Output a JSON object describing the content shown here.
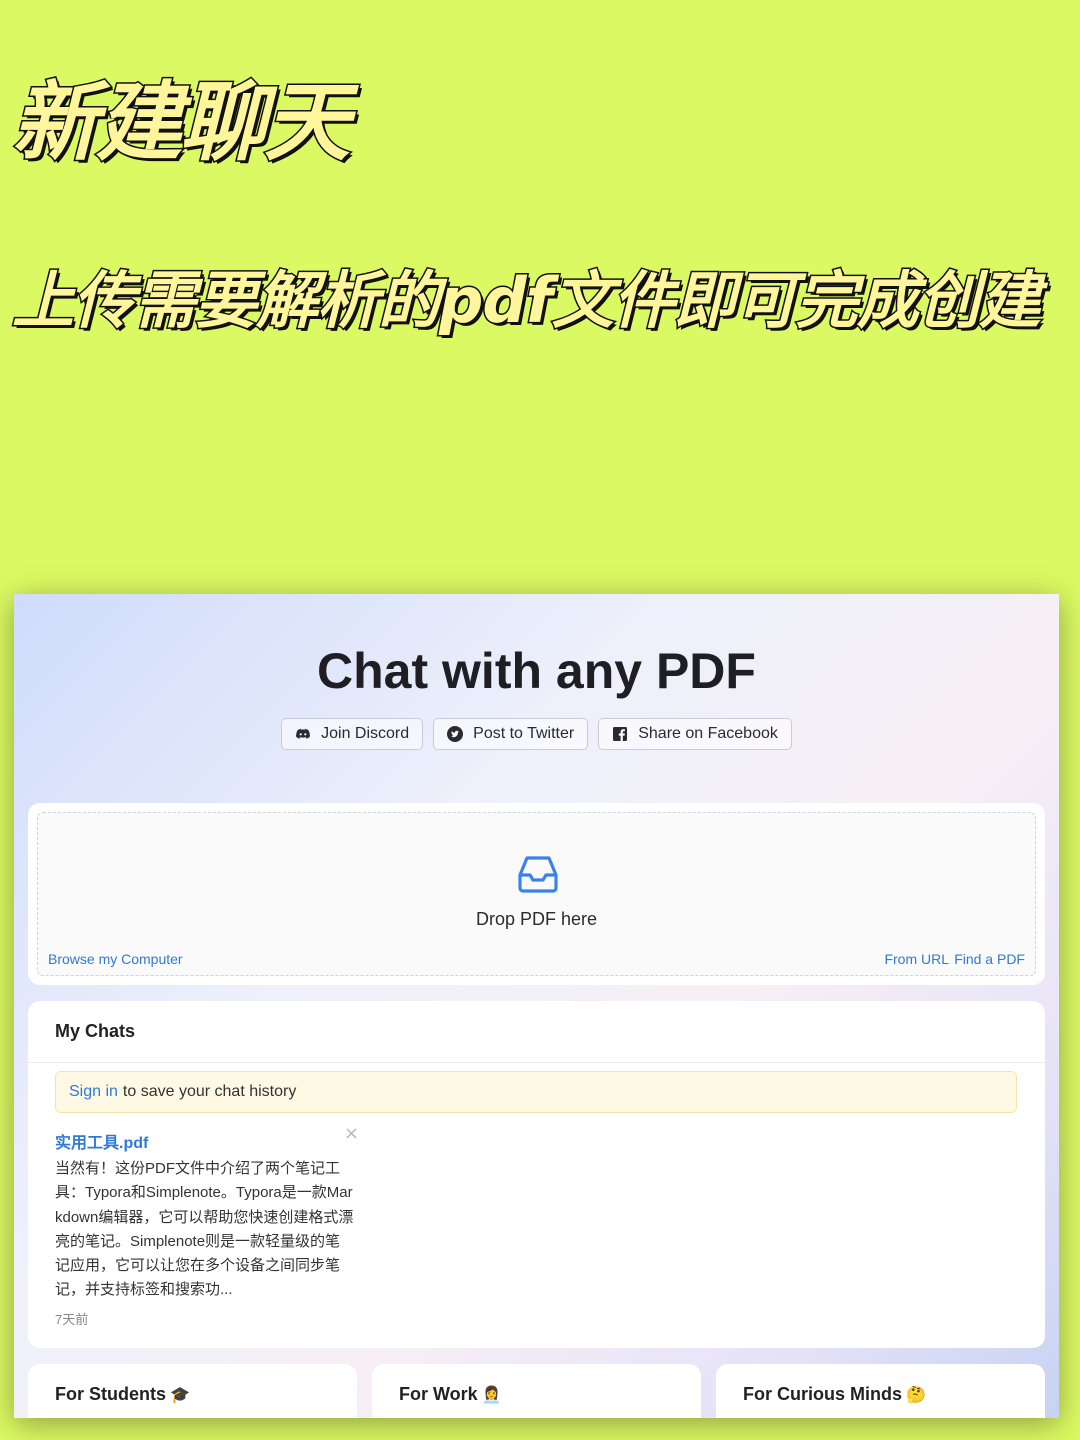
{
  "headline": {
    "title": "新建聊天",
    "subtitle": "上传需要解析的pdf文件即可完成创建"
  },
  "app": {
    "title": "Chat with any PDF",
    "share_buttons": [
      {
        "label": "Join Discord",
        "icon": "discord-icon"
      },
      {
        "label": "Post to Twitter",
        "icon": "twitter-icon"
      },
      {
        "label": "Share on Facebook",
        "icon": "facebook-icon"
      }
    ],
    "upload": {
      "icon": "inbox-icon",
      "drop_text": "Drop PDF here",
      "browse_label": "Browse my Computer",
      "from_url_label": "From URL",
      "find_pdf_label": "Find a PDF"
    },
    "chats": {
      "title": "My Chats",
      "signin_link": "Sign in",
      "signin_text": "to save your chat history",
      "items": [
        {
          "name": "实用工具.pdf",
          "preview": "当然有！这份PDF文件中介绍了两个笔记工具：Typora和Simplenote。Typora是一款Markdown编辑器，它可以帮助您快速创建格式漂亮的笔记。Simplenote则是一款轻量级的笔记应用，它可以让您在多个设备之间同步笔记，并支持标签和搜索功...",
          "time": "7天前",
          "close": "×"
        }
      ]
    },
    "categories": [
      {
        "label": "For Students",
        "emoji": "🎓"
      },
      {
        "label": "For Work",
        "emoji": "👩‍💼"
      },
      {
        "label": "For Curious Minds",
        "emoji": "🤔"
      }
    ],
    "colors": {
      "page_background": "#dbf962",
      "link": "#2f7ad6",
      "icon_blue": "#3b82e8"
    }
  }
}
